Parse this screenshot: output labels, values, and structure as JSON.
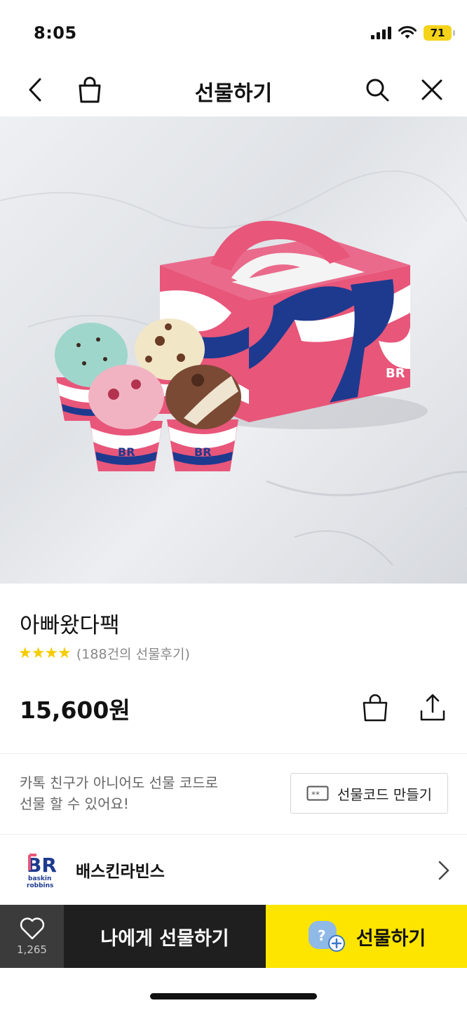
{
  "status_bar": {
    "time": "8:05",
    "battery": "71"
  },
  "nav": {
    "title": "선물하기"
  },
  "product": {
    "name": "아빠왔다팩",
    "stars": "★★★★",
    "review_count": "(188건의 선물후기)",
    "price": "15,600원"
  },
  "gift_code": {
    "description_line1": "카톡 친구가 아니어도 선물 코드로",
    "description_line2": "선물 할 수 있어요!",
    "button_label": "선물코드 만들기"
  },
  "brand": {
    "name": "배스킨라빈스",
    "logo_text": "BR"
  },
  "bottom_bar": {
    "like_count": "1,265",
    "self_gift_label": "나에게 선물하기",
    "gift_label": "선물하기"
  },
  "colors": {
    "kakao_yellow": "#fee500",
    "brand_pink": "#e8567a",
    "brand_blue": "#1d3a8f",
    "star": "#f5cc00"
  },
  "icons": {
    "nav_back": "chevron-left-icon",
    "nav_bag": "shopping-bag-icon",
    "nav_search": "search-icon",
    "nav_close": "close-icon",
    "cart": "shopping-bag-icon",
    "share": "share-icon",
    "gift_code": "ticket-icon",
    "brand_chevron": "chevron-right-icon",
    "like": "heart-icon",
    "friend_add": "friend-add-icon"
  }
}
